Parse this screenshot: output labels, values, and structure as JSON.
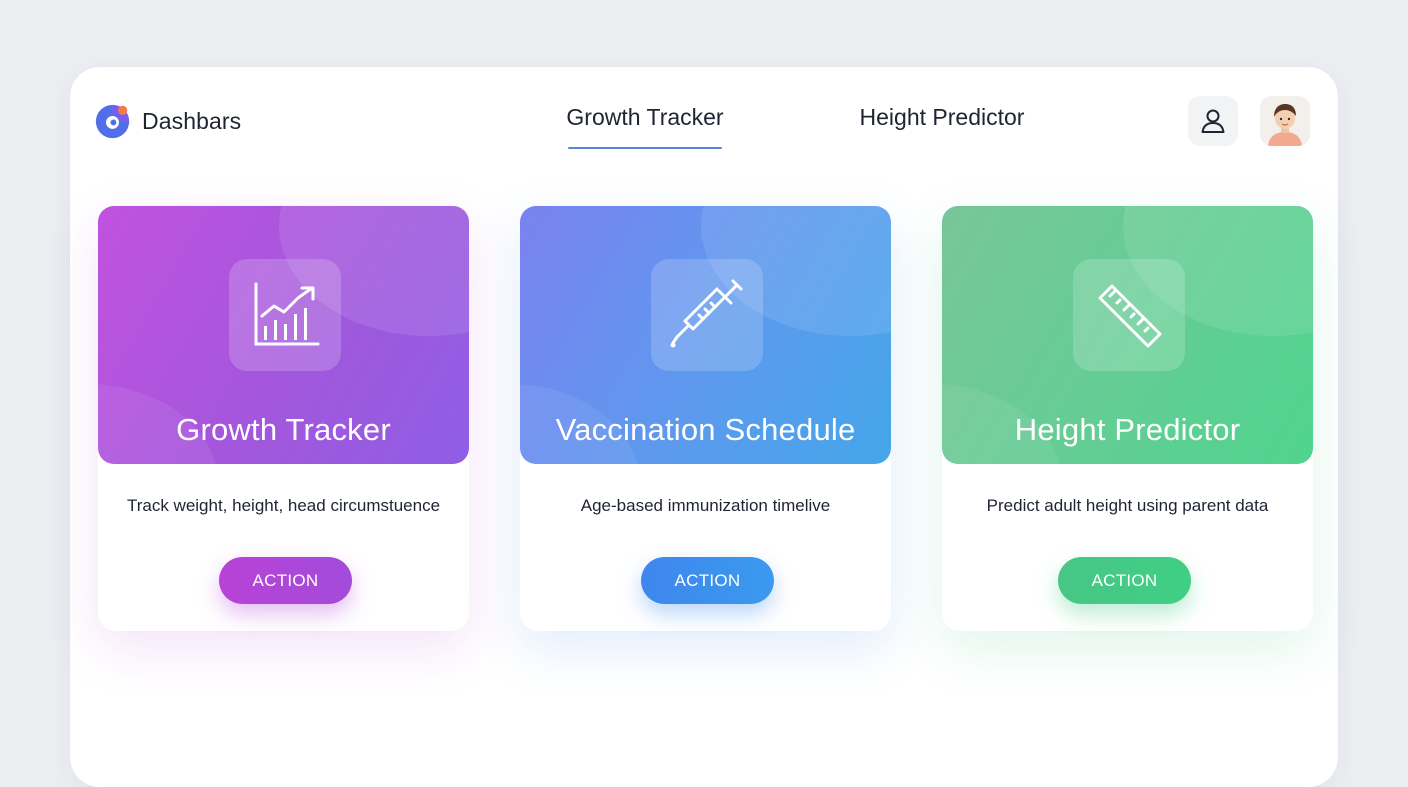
{
  "header": {
    "brand_name": "Dashbars",
    "tabs": [
      {
        "label": "Growth Tracker",
        "active": true
      },
      {
        "label": "Height Predictor",
        "active": false
      }
    ],
    "user_icon": "user-icon",
    "avatar_icon": "avatar"
  },
  "cards": [
    {
      "title": "Growth Tracker",
      "description": "Track weight, height, head circumstuence",
      "action_label": "ACTION",
      "icon": "growth-chart-icon",
      "accent": "#b146d9"
    },
    {
      "title": "Vaccination Schedule",
      "description": "Age-based immunization timelive",
      "action_label": "ACTION",
      "icon": "syringe-icon",
      "accent": "#3f8fee"
    },
    {
      "title": "Height Predictor",
      "description": "Predict adult height using parent data",
      "action_label": "ACTION",
      "icon": "ruler-icon",
      "accent": "#45c984"
    }
  ],
  "colors": {
    "background": "#eceef2",
    "panel": "#ffffff",
    "tab_underline": "#5a86d6",
    "text": "#1f2433"
  }
}
